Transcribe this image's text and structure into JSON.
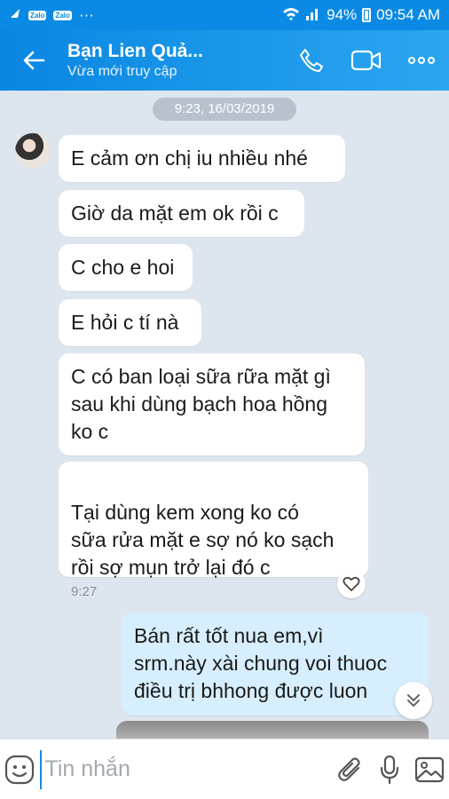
{
  "status_bar": {
    "app_badges": [
      "Zalo",
      "Zalo"
    ],
    "dots": "···",
    "battery": "94%",
    "time": "09:54 AM"
  },
  "header": {
    "title": "Bạn Lien Quả...",
    "subtitle": "Vừa mới truy cập",
    "icons": [
      "back-arrow-icon",
      "phone-icon",
      "video-call-icon",
      "more-icon"
    ]
  },
  "chat": {
    "date_separator": "9:23, 16/03/2019",
    "messages": [
      {
        "text": "E cảm ơn chị iu  nhiều nhé"
      },
      {
        "text": "Giờ da mặt em ok rồi c"
      },
      {
        "text": "C cho e hoi"
      },
      {
        "text": "E hỏi c tí nà"
      },
      {
        "text": "C có ban loại sữa rữa mặt gì\nsau khi dùng bạch hoa hồng\nko c"
      },
      {
        "text": "Tại dùng kem xong ko có\nsữa rửa mặt e sợ nó ko sạch\nrồi sợ mụn trở lại đó c",
        "time": "9:27"
      },
      {
        "text": "Bán rất tốt nua em,vì\nsrm.này xài chung voi thuoc\nđiều trị bhhong được luon"
      }
    ]
  },
  "input_bar": {
    "placeholder": "Tin nhắn",
    "icons": [
      "emoji-icon",
      "attachment-icon",
      "microphone-icon",
      "image-icon"
    ]
  },
  "colors": {
    "header_start": "#0a86e2",
    "header_end": "#2aa6f0",
    "chat_bg": "#dde6ef",
    "my_bubble": "#d6eefd"
  }
}
